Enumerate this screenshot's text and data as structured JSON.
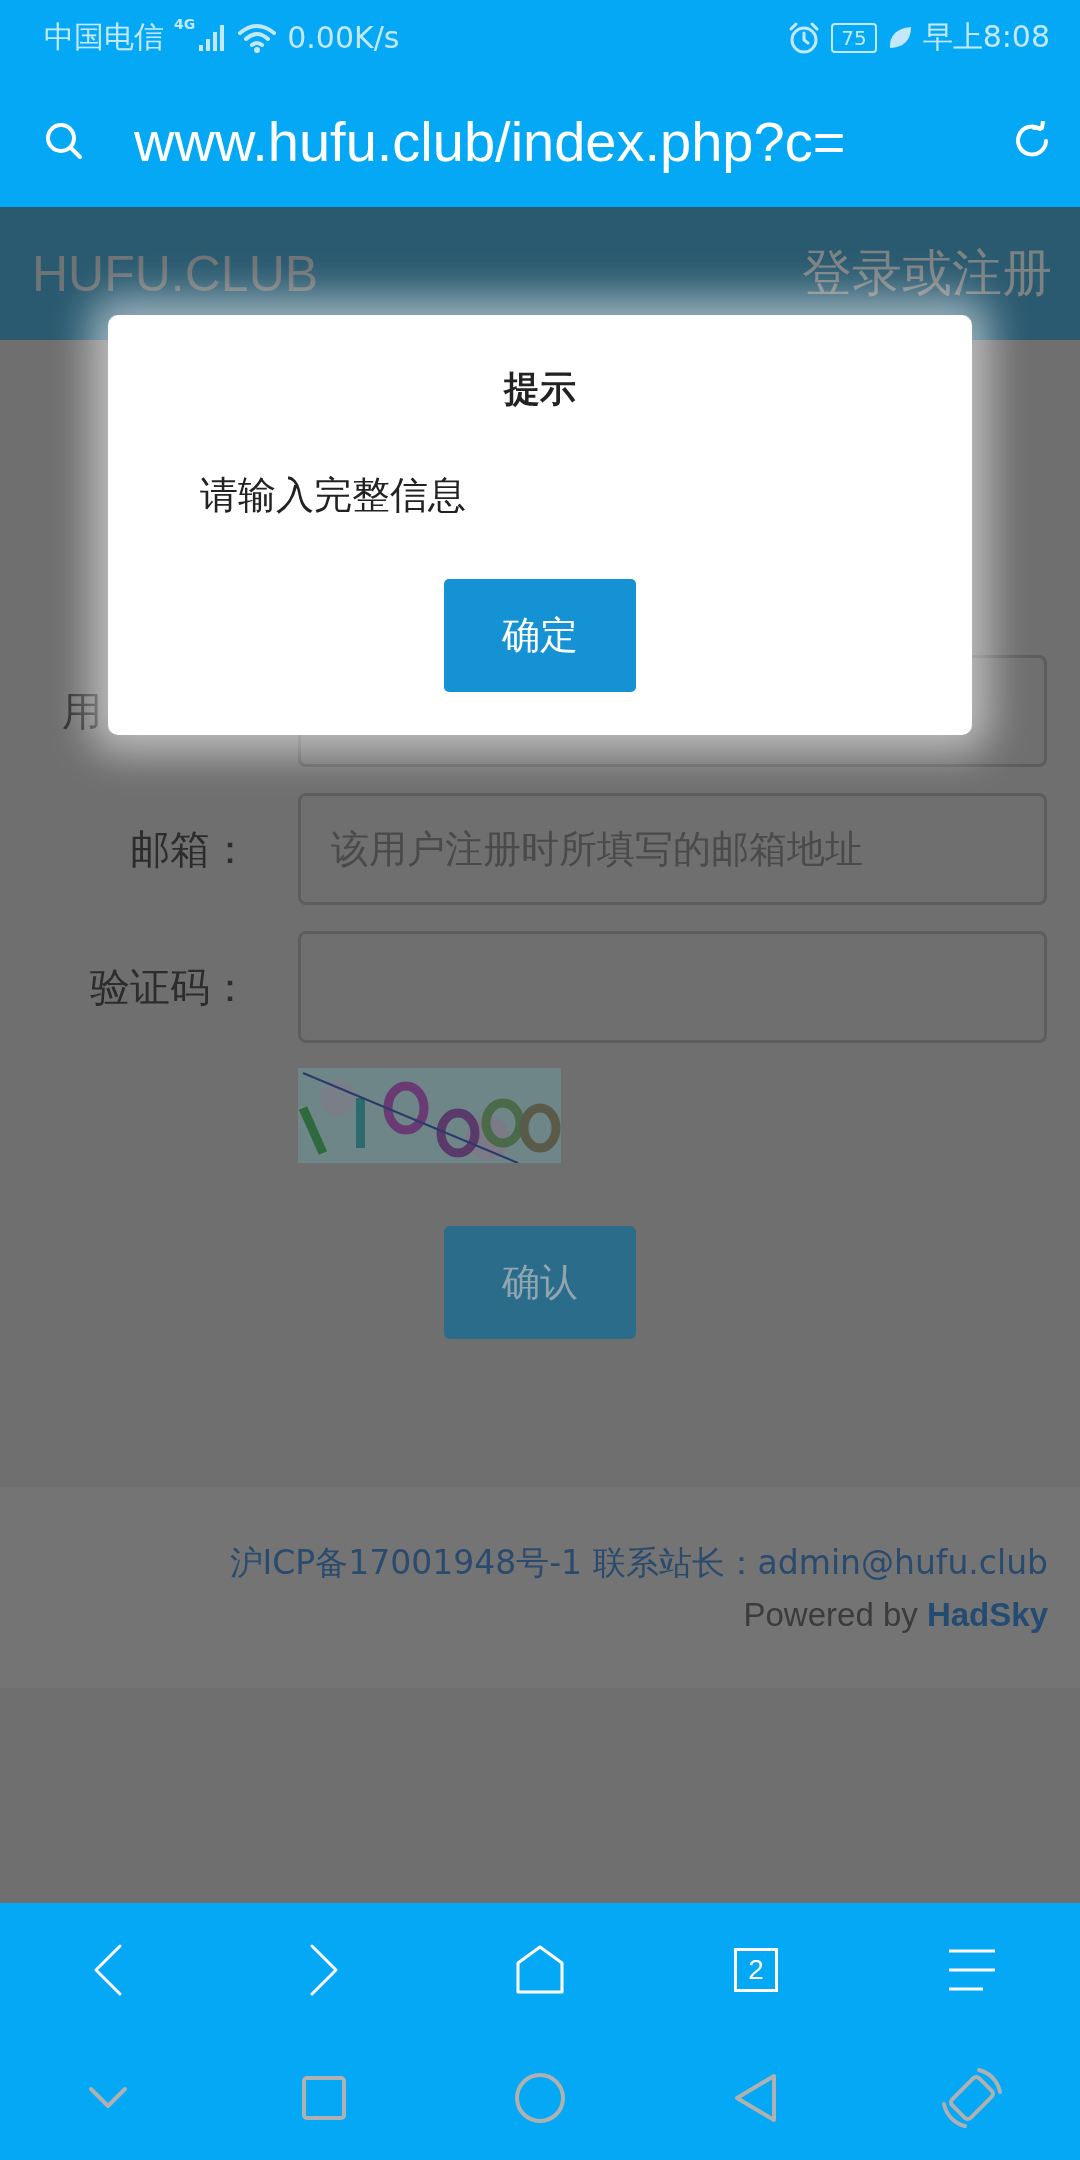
{
  "status_bar": {
    "carrier": "中国电信",
    "network": "4G",
    "speed": "0.00K/s",
    "battery": "75",
    "time": "早上8:08"
  },
  "address_bar": {
    "url": "www.hufu.club/index.php?c="
  },
  "site_header": {
    "logo": "HUFU.CLUB",
    "login_link": "登录或注册"
  },
  "form": {
    "fields": [
      {
        "label": "用"
      },
      {
        "label": "邮箱：",
        "placeholder": "该用户注册时所填写的邮箱地址"
      },
      {
        "label": "验证码："
      }
    ],
    "submit": "确认"
  },
  "footer": {
    "icp": "沪ICP备17001948号-1 联系站长：admin@hufu.club",
    "powered_by": "Powered by **HadSky**"
  },
  "dialog": {
    "title": "提示",
    "message": "请输入完整信息",
    "ok": "确定"
  },
  "browser_toolbar": {
    "tab_count": "2"
  }
}
